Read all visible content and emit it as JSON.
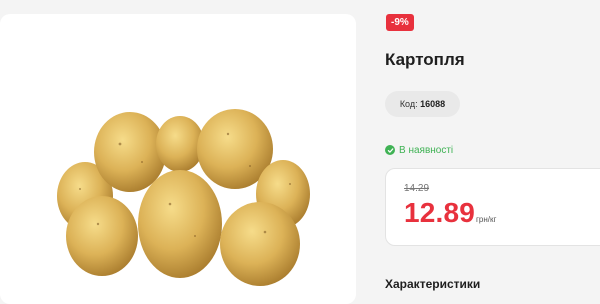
{
  "product": {
    "discount_badge": "-9%",
    "title": "Картопля",
    "code_label": "Код:",
    "code_value": "16088",
    "stock_status": "В наявності",
    "old_price": "14.29",
    "price": "12.89",
    "price_unit": "грн/кг",
    "characteristics_heading": "Характеристики"
  },
  "colors": {
    "accent": "#e8313d",
    "in_stock": "#3fb254"
  },
  "icons": {
    "stock": "check-circle-icon"
  }
}
